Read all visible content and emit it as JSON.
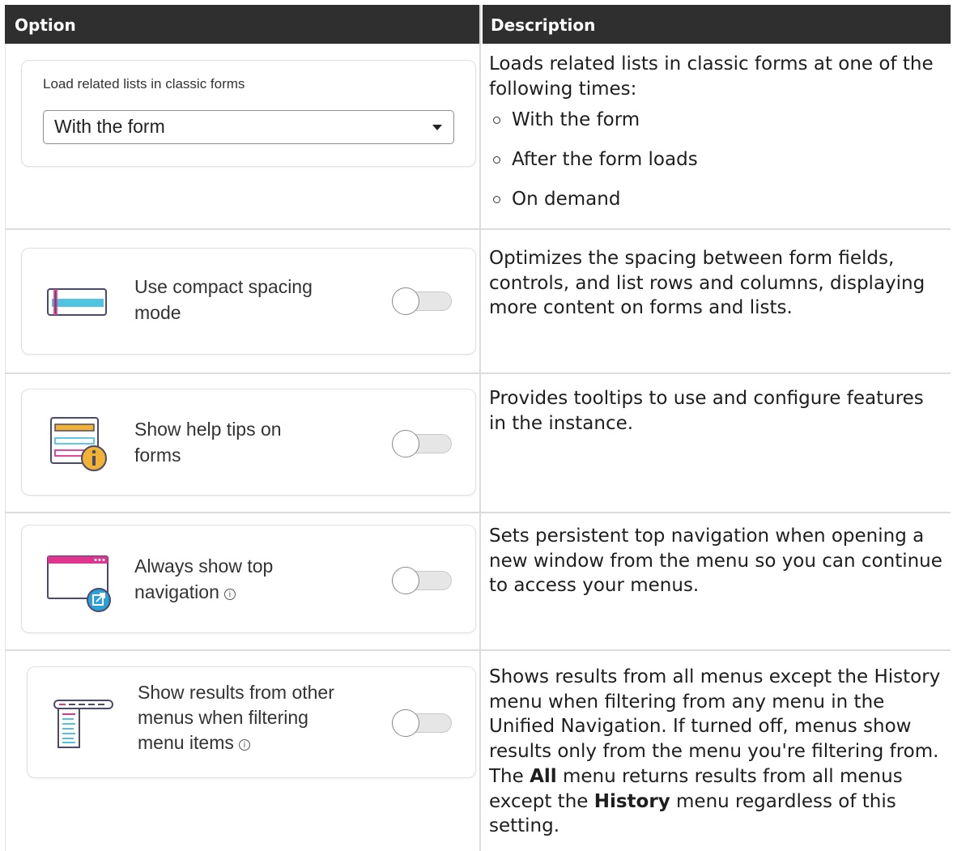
{
  "header": {
    "option": "Option",
    "description": "Description"
  },
  "row1": {
    "select_label": "Load related lists in classic forms",
    "select_value": "With the form",
    "desc_intro": "Loads related lists in classic forms at one of the following times:",
    "desc_options": [
      "With the form",
      "After the form loads",
      "On demand"
    ]
  },
  "row2": {
    "label_line1": "Use compact spacing",
    "label_line2": "mode",
    "desc": "Optimizes the spacing between form fields, controls, and list rows and columns, displaying more content on forms and lists."
  },
  "row3": {
    "label_line1": "Show help tips on",
    "label_line2": "forms",
    "desc": "Provides tooltips to use and configure features in the instance."
  },
  "row4": {
    "label_line1": "Always show top",
    "label_line2": "navigation",
    "desc": "Sets persistent top navigation when opening a new window from the menu so you can continue to access your menus."
  },
  "row5": {
    "label_line1": "Show results from other",
    "label_line2": "menus when filtering",
    "label_line3": "menu items",
    "desc_part1": "Shows results from all menus except the History menu when filtering from any menu in the Unified Navigation. If turned off, menus show results only from the menu you're filtering from. The ",
    "desc_bold1": "All",
    "desc_part2": " menu returns results from all menus except the ",
    "desc_bold2": "History",
    "desc_part3": " menu regardless of this setting."
  },
  "icons": {
    "compact": "compact-spacing-icon",
    "help": "help-tips-icon",
    "topnav": "top-navigation-icon",
    "menus": "menu-results-icon"
  },
  "colors": {
    "header_bg": "#2f2f2f",
    "accent_teal": "#4fc3e0",
    "accent_pink": "#e0358f",
    "accent_yellow": "#f2b233",
    "accent_blue": "#2d9fd9"
  }
}
